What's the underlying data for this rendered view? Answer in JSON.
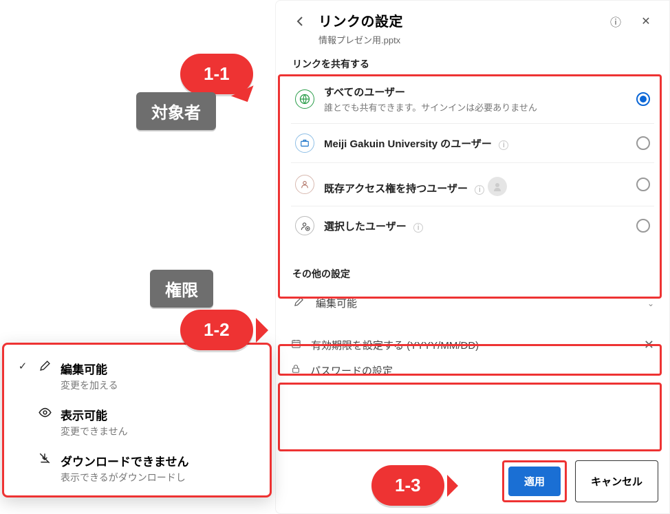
{
  "header": {
    "title": "リンクの設定",
    "file": "情報プレゼン用.pptx"
  },
  "share": {
    "section": "リンクを共有する",
    "opts": [
      {
        "title": "すべてのユーザー",
        "desc": "誰とでも共有できます。サインインは必要ありません",
        "selected": true
      },
      {
        "title": "Meiji Gakuin University のユーザー",
        "info": true
      },
      {
        "title": "既存アクセス権を持つユーザー",
        "info": true,
        "avatar": true
      },
      {
        "title": "選択したユーザー",
        "info": true
      }
    ]
  },
  "other": {
    "section": "その他の設定",
    "edit_label": "編集可能",
    "expire_label": "有効期限を設定する (YYYY/MM/DD)",
    "password_label": "パスワードの設定"
  },
  "footer": {
    "apply": "適用",
    "cancel": "キャンセル"
  },
  "editmenu": {
    "items": [
      {
        "title": "編集可能",
        "desc": "変更を加える",
        "checked": true
      },
      {
        "title": "表示可能",
        "desc": "変更できません"
      },
      {
        "title": "ダウンロードできません",
        "desc": "表示できるがダウンロードし"
      }
    ]
  },
  "callouts": {
    "c11": "1-1",
    "c12": "1-2",
    "c13": "1-3",
    "target": "対象者",
    "perm": "権限"
  }
}
